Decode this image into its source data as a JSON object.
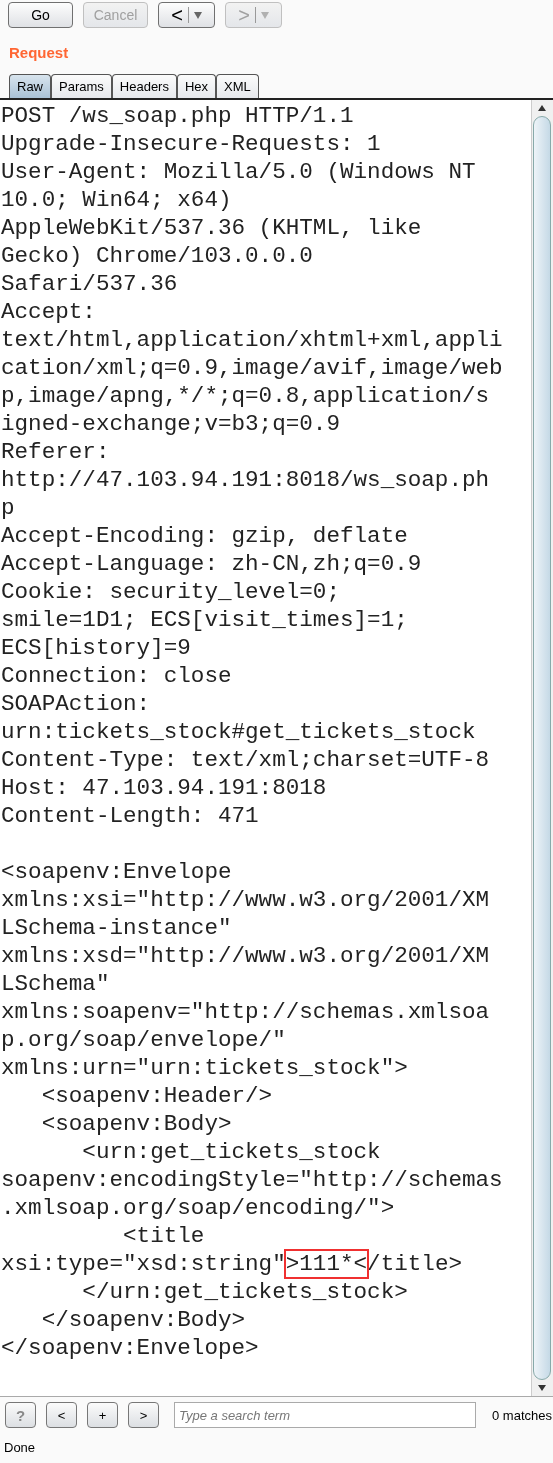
{
  "toolbar": [
    {
      "kind": "text",
      "label": "Go",
      "disabled": false
    },
    {
      "kind": "text",
      "label": "Cancel",
      "disabled": true
    },
    {
      "kind": "back",
      "label": "<",
      "disabled": false
    },
    {
      "kind": "forward",
      "label": ">",
      "disabled": true
    }
  ],
  "panel_title": "Request",
  "tabs": [
    {
      "label": "Raw",
      "selected": true
    },
    {
      "label": "Params",
      "selected": false
    },
    {
      "label": "Headers",
      "selected": false
    },
    {
      "label": "Hex",
      "selected": false
    },
    {
      "label": "XML",
      "selected": false
    }
  ],
  "editor_lines": [
    {
      "text": "POST /ws_soap.php HTTP/1.1"
    },
    {
      "text": "Upgrade-Insecure-Requests: 1"
    },
    {
      "text": "User-Agent: Mozilla/5.0 (Windows NT"
    },
    {
      "text": "10.0; Win64; x64)"
    },
    {
      "text": "AppleWebKit/537.36 (KHTML, like"
    },
    {
      "text": "Gecko) Chrome/103.0.0.0"
    },
    {
      "text": "Safari/537.36"
    },
    {
      "text": "Accept:"
    },
    {
      "text": "text/html,application/xhtml+xml,appli"
    },
    {
      "text": "cation/xml;q=0.9,image/avif,image/web"
    },
    {
      "text": "p,image/apng,*/*;q=0.8,application/s"
    },
    {
      "text": "igned-exchange;v=b3;q=0.9"
    },
    {
      "text": "Referer:"
    },
    {
      "text": "http://47.103.94.191:8018/ws_soap.ph"
    },
    {
      "text": "p"
    },
    {
      "text": "Accept-Encoding: gzip, deflate"
    },
    {
      "text": "Accept-Language: zh-CN,zh;q=0.9"
    },
    {
      "text": "Cookie: security_level=0;"
    },
    {
      "text": "smile=1D1; ECS[visit_times]=1;"
    },
    {
      "text": "ECS[history]=9"
    },
    {
      "text": "Connection: close"
    },
    {
      "text": "SOAPAction:"
    },
    {
      "text": "urn:tickets_stock#get_tickets_stock"
    },
    {
      "text": "Content-Type: text/xml;charset=UTF-8"
    },
    {
      "text": "Host: 47.103.94.191:8018"
    },
    {
      "text": "Content-Length: 471"
    }
  ],
  "body_lines": [
    {
      "text": "<soapenv:Envelope"
    },
    {
      "text": "xmlns:xsi=\"http://www.w3.org/2001/XM"
    },
    {
      "text": "LSchema-instance\""
    },
    {
      "text": "xmlns:xsd=\"http://www.w3.org/2001/XM"
    },
    {
      "text": "LSchema\""
    },
    {
      "text": "xmlns:soapenv=\"http://schemas.xmlsoa"
    },
    {
      "text": "p.org/soap/envelope/\""
    },
    {
      "text": "xmlns:urn=\"urn:tickets_stock\">"
    },
    {
      "text": "   <soapenv:Header/>"
    },
    {
      "text": "   <soapenv:Body>"
    },
    {
      "text": "      <urn:get_tickets_stock"
    },
    {
      "text": "soapenv:encodingStyle=\"http://schemas"
    },
    {
      "text": ".xmlsoap.org/soap/encoding/\">"
    },
    {
      "text": "         <title"
    },
    {
      "text": "xsi:type=\"xsd:string\"",
      "marked": ">111*<",
      "after": "/title>"
    },
    {
      "text": "      </urn:get_tickets_stock>"
    },
    {
      "text": "   </soapenv:Body>"
    },
    {
      "text": "</soapenv:Envelope>"
    }
  ],
  "search_bar": {
    "buttons": [
      "?",
      "<",
      "+",
      ">"
    ],
    "placeholder": "Type a search term",
    "matches": "0 matches"
  },
  "status": "Done"
}
